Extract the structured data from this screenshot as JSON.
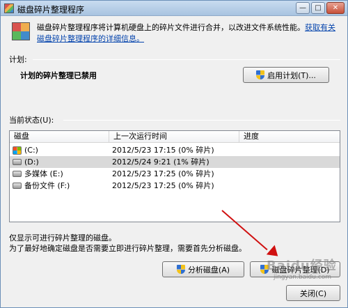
{
  "window": {
    "title": "磁盘碎片整理程序",
    "minimize": "—",
    "maximize": "□",
    "close": "✕"
  },
  "intro": {
    "text": "磁盘碎片整理程序将计算机硬盘上的碎片文件进行合并，以改进文件系统性能。",
    "link": "获取有关磁盘碎片整理程序的详细信息。"
  },
  "schedule": {
    "label": "计划:",
    "status": "计划的碎片整理已禁用",
    "enable_button": "启用计划(T)..."
  },
  "current": {
    "label": "当前状态(U):",
    "columns": [
      "磁盘",
      "上一次运行时间",
      "进度"
    ],
    "rows": [
      {
        "disk": "(C:)",
        "last_run": "2012/5/23 17:15 (0% 碎片)",
        "progress": "",
        "icon": "system-drive-icon",
        "selected": false
      },
      {
        "disk": "(D:)",
        "last_run": "2012/5/24 9:21 (1% 碎片)",
        "progress": "",
        "icon": "drive-icon",
        "selected": true
      },
      {
        "disk": "多媒体 (E:)",
        "last_run": "2012/5/23 17:25 (0% 碎片)",
        "progress": "",
        "icon": "drive-icon",
        "selected": false
      },
      {
        "disk": "备份文件 (F:)",
        "last_run": "2012/5/23 17:25 (0% 碎片)",
        "progress": "",
        "icon": "drive-icon",
        "selected": false
      }
    ]
  },
  "notes": {
    "line1": "仅显示可进行碎片整理的磁盘。",
    "line2": "为了最好地确定磁盘是否需要立即进行碎片整理，需要首先分析磁盘。"
  },
  "buttons": {
    "analyze": "分析磁盘(A)",
    "defrag": "磁盘碎片整理(D)",
    "close": "关闭(C)"
  },
  "watermark": {
    "main": "Baidu经验",
    "sub": "jingyan.baidu.com"
  },
  "colors": {
    "link": "#0645ad",
    "annotation_arrow": "#d01010",
    "selected_row": "#d9d9d9"
  }
}
